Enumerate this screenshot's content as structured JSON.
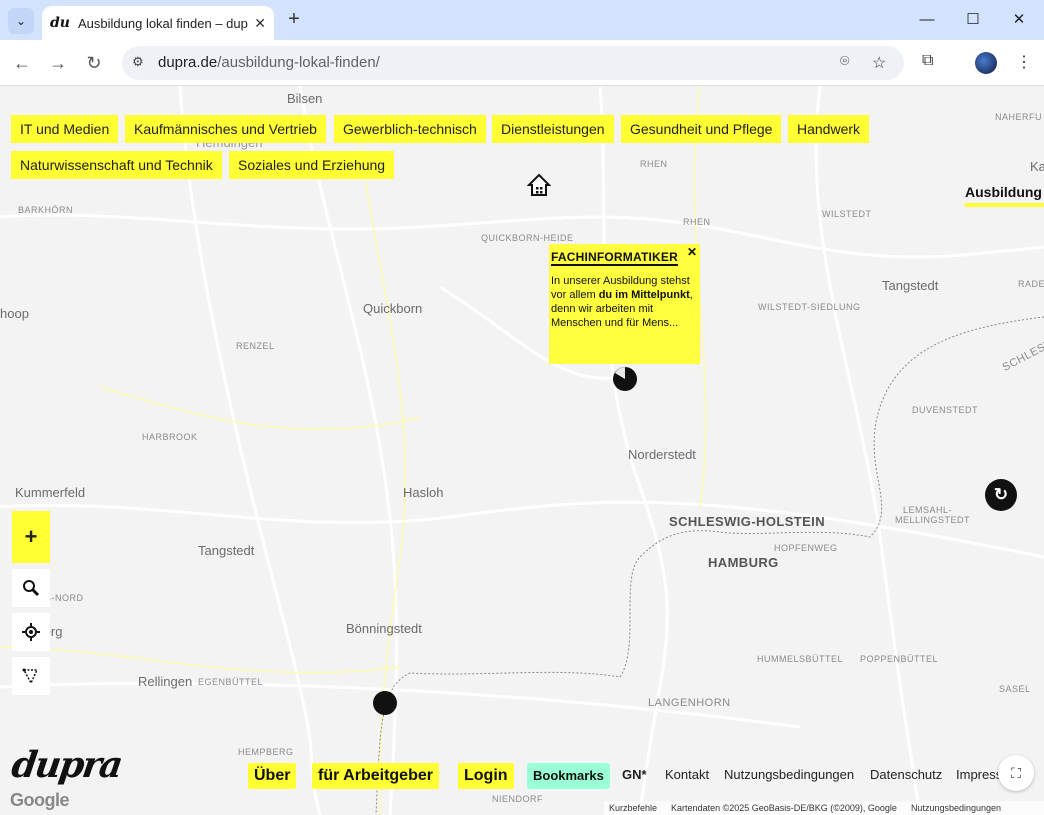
{
  "browser": {
    "tab_title": "Ausbildung lokal finden – dupra",
    "url_host": "dupra.de",
    "url_path": "/ausbildung-lokal-finden/"
  },
  "categories": [
    "IT und Medien",
    "Kaufmännisches und Vertrieb",
    "Gewerblich-technisch",
    "Dienstleistungen",
    "Gesundheit und Pflege",
    "Handwerk",
    "Naturwissenschaft und Technik",
    "Soziales und Erziehung"
  ],
  "side_tab": "Ausbildung",
  "places": {
    "bilsen": "Bilsen",
    "hemdingen": "Hemdingen",
    "barkhorn": "BARKHÖRN",
    "quickborn_heide": "QUICKBORN-HEIDE",
    "rhen": "RHEN",
    "rhen2": "RHEN",
    "wilstedt": "WILSTEDT",
    "naherfu": "NAHERFU",
    "tangstedt_ne": "Tangstedt",
    "wilstedt_siedlung": "WILSTEDT-SIEDLUNG",
    "quickborn": "Quickborn",
    "renzel": "RENZEL",
    "hoop": "hoop",
    "harbrook": "HARBROOK",
    "duvenstedt": "DUVENSTEDT",
    "norderstedt": "Norderstedt",
    "kummerfeld": "Kummerfeld",
    "hasloh": "Hasloh",
    "schleswig_holstein": "SCHLESWIG-HOLSTEIN",
    "lemsahl": "LEMSAHL-",
    "mellingstedt": "MELLINGSTEDT",
    "tangstedt_sw": "Tangstedt",
    "hamburg": "HAMBURG",
    "hopfenweg": "HOPFENWEG",
    "berg_nord": "BERG-NORD",
    "heberg": "heberg",
    "bonningstedt": "Bönningstedt",
    "hummelsbuttel": "HUMMELSBÜTTEL",
    "poppenbuttel": "POPPENBÜTTEL",
    "rellingen": "Rellingen",
    "egenbuttel": "EGENBÜTTEL",
    "langenhorn": "LANGENHORN",
    "sasel": "SASEL",
    "hempberg": "HEMPBERG",
    "niendorf": "NIENDORF",
    "schlesw": "SCHLESW",
    "rade": "RADE",
    "ka": "Ka"
  },
  "popup": {
    "title": "FACHINFORMATIKER",
    "text_before": "In unserer Ausbildung stehst vor allem ",
    "text_bold": "du im Mittelpunkt",
    "text_after": ", denn wir arbeiten mit Menschen und für Mens..."
  },
  "controls": {
    "zoom_in": "+"
  },
  "logo": "dupra",
  "google": "Google",
  "footer": {
    "uber": "Über",
    "arbeitgeber": "für Arbeitgeber",
    "login": "Login",
    "bookmarks": "Bookmarks",
    "gn": "GN*",
    "kontakt": "Kontakt",
    "nutzung": "Nutzungsbedingungen",
    "datenschutz": "Datenschutz",
    "impressum": "Impressum"
  },
  "attribution": {
    "kurzbefehle": "Kurzbefehle",
    "kartendaten": "Kartendaten ©2025 GeoBasis-DE/BKG (©2009), Google",
    "nutzung": "Nutzungsbedingungen"
  },
  "colors": {
    "accent_yellow": "#ffff33",
    "mint": "#99ffd6",
    "tabbar": "#d3e3fd"
  }
}
